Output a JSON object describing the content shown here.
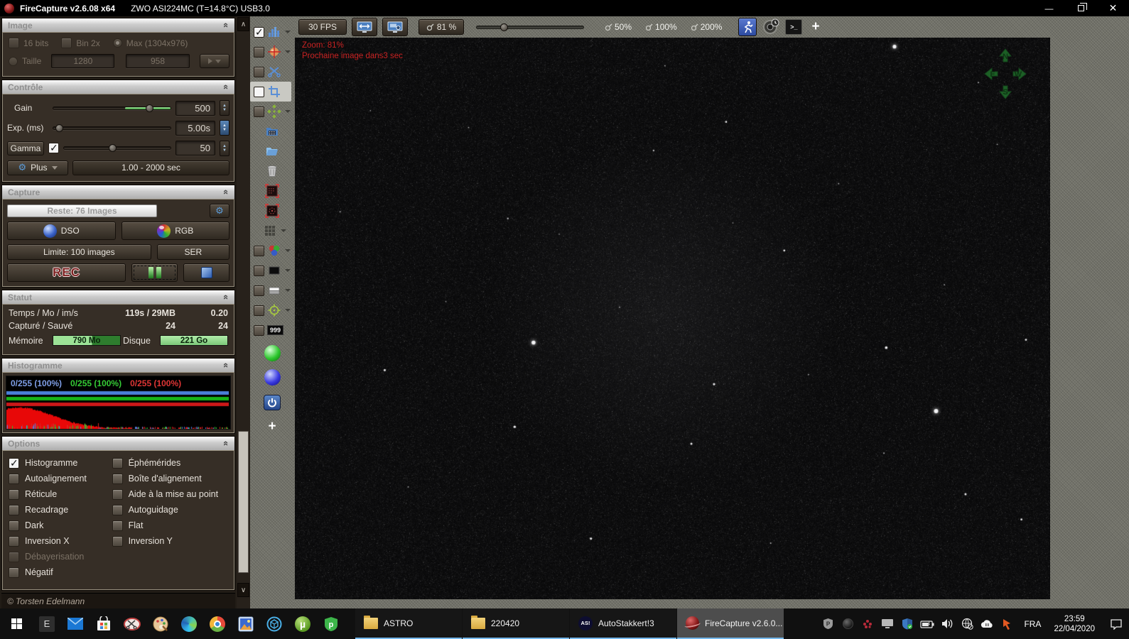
{
  "titlebar": {
    "app": "FireCapture v2.6.08  x64",
    "device": "ZWO ASI224MC (T=14.8°C) USB3.0"
  },
  "image_panel": {
    "title": "Image",
    "bits": "16 bits",
    "bin": "Bin 2x",
    "max": "Max (1304x976)",
    "taille": "Taille",
    "width_value": "1280",
    "height_value": "958"
  },
  "controle": {
    "title": "Contrôle",
    "gain_label": "Gain",
    "gain_value": "500",
    "exp_label": "Exp. (ms)",
    "exp_value": "5.00s",
    "gamma_label": "Gamma",
    "gamma_value": "50",
    "plus_label": "Plus",
    "range_label": "1.00 - 2000 sec"
  },
  "capture": {
    "title": "Capture",
    "reste": "Reste: 76 Images",
    "dso": "DSO",
    "rgb": "RGB",
    "limite": "Limite: 100 images",
    "ser": "SER",
    "rec": "REC"
  },
  "statut": {
    "title": "Statut",
    "row1_label": "Temps / Mo / im/s",
    "row1_v1": "119s / 29MB",
    "row1_v2": "0.20",
    "row2_label": "Capturé / Sauvé",
    "row2_v1": "24",
    "row2_v2": "24",
    "mem_label": "Mémoire",
    "mem_value": "790 Mo",
    "disk_label": "Disque",
    "disk_value": "221 Go"
  },
  "histogramme": {
    "title": "Histogramme",
    "blue": "0/255 (100%)",
    "green": "0/255 (100%)",
    "red": "0/255 (100%)"
  },
  "options": {
    "title": "Options",
    "left": [
      {
        "label": "Histogramme",
        "checked": true
      },
      {
        "label": "Autoalignement"
      },
      {
        "label": "Réticule"
      },
      {
        "label": "Recadrage"
      },
      {
        "label": "Dark"
      },
      {
        "label": "Inversion X"
      },
      {
        "label": "Débayerisation",
        "disabled": true
      },
      {
        "label": "Négatif"
      }
    ],
    "right": [
      {
        "label": "Éphémérides"
      },
      {
        "label": "Boîte d'alignement"
      },
      {
        "label": "Aide à la mise au point"
      },
      {
        "label": "Autoguidage"
      },
      {
        "label": "Flat"
      },
      {
        "label": "Inversion Y"
      }
    ]
  },
  "copyright": "© Torsten Edelmann",
  "viewer": {
    "fps": "30 FPS",
    "zoom": "81 %",
    "z50": "50%",
    "z100": "100%",
    "z200": "200%",
    "overlay1": "Zoom: 81%",
    "overlay2": "Prochaine image dans3 sec",
    "compass_n": "N",
    "compass_e": "E",
    "compass_w": "W",
    "compass_s": "S",
    "counter_badge": "999",
    "accent_green": "#2e8b3a",
    "overlay_red": "#c92222",
    "stars": [
      [
        0.794,
        0.016,
        2.6
      ],
      [
        0.571,
        0.15,
        1.3
      ],
      [
        0.475,
        0.201,
        1.2
      ],
      [
        0.282,
        0.322,
        1.2
      ],
      [
        0.648,
        0.379,
        1.4
      ],
      [
        0.316,
        0.543,
        2.8
      ],
      [
        0.119,
        0.592,
        1.5
      ],
      [
        0.555,
        0.617,
        1.6
      ],
      [
        0.783,
        0.552,
        1.9
      ],
      [
        0.968,
        0.538,
        1.4
      ],
      [
        0.849,
        0.665,
        3.0
      ],
      [
        0.291,
        0.693,
        1.7
      ],
      [
        0.525,
        0.723,
        1.5
      ],
      [
        0.392,
        0.892,
        1.6
      ],
      [
        0.888,
        0.813,
        1.5
      ],
      [
        0.962,
        0.858,
        1.4
      ],
      [
        0.23,
        0.16,
        0.9
      ],
      [
        0.72,
        0.26,
        0.9
      ],
      [
        0.43,
        0.48,
        0.9
      ],
      [
        0.78,
        0.74,
        1.0
      ],
      [
        0.15,
        0.8,
        0.9
      ],
      [
        0.63,
        0.9,
        1.0
      ],
      [
        0.06,
        0.31,
        0.9
      ],
      [
        0.93,
        0.19,
        0.9
      ],
      [
        0.49,
        0.05,
        0.9
      ],
      [
        0.35,
        0.35,
        0.8
      ],
      [
        0.58,
        0.33,
        0.8
      ],
      [
        0.86,
        0.44,
        0.9
      ],
      [
        0.2,
        0.47,
        0.8
      ],
      [
        0.68,
        0.6,
        0.9
      ],
      [
        0.1,
        0.13,
        0.8
      ],
      [
        0.905,
        0.08,
        1.0
      ]
    ]
  },
  "taskbar": {
    "apps": [
      {
        "label": "ASTRO"
      },
      {
        "label": "220420"
      },
      {
        "label": "AutoStakkert!3"
      },
      {
        "label": "FireCapture v2.6.0..."
      }
    ],
    "as_badge": "AS!",
    "e_badge": "E",
    "lang": "FRA",
    "time": "23:59",
    "date": "22/04/2020"
  }
}
